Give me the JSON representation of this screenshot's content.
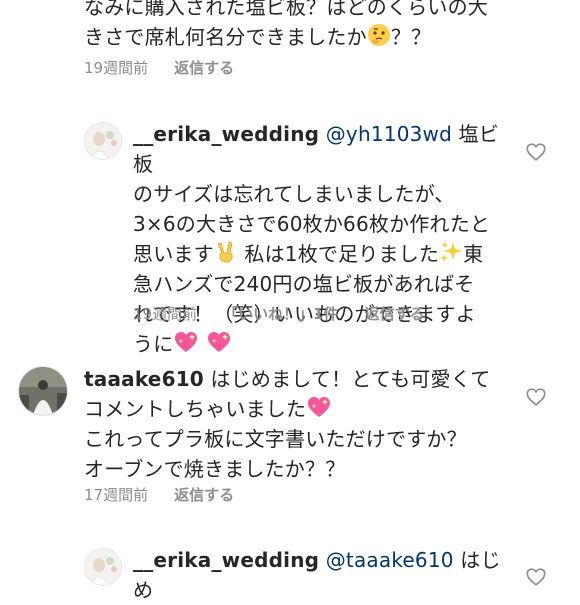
{
  "comments": [
    {
      "text": "なみに購入された塩ビ板？はどのくらいの大\nきさで席札何名分できましたか",
      "text_tail": "？？",
      "time": "19週間前",
      "reply": "返信する"
    },
    {
      "username": "__erika_wedding",
      "mention": "@yh1103wd",
      "line1": " 塩ビ板",
      "body1": "のサイズは忘れてしまいましたが、\n3×6の大きさで60枚か66枚か作れたと\n思います",
      "body2": " 私は1枚で足りました",
      "body3": "東\n急ハンズで240円の塩ビ板があればそ\nれです！（笑）いいものができますよ\nうに",
      "time": "19週間前",
      "likes": "「いいね！」1件",
      "reply": "返信する"
    },
    {
      "username": "taaake610",
      "body1": " はじめまして！とても可愛くて\nコメントしちゃいました",
      "body2": "\nこれってプラ板に文字書いただけですか？\nオーブンで焼きましたか？？",
      "time": "17週間前",
      "reply": "返信する"
    },
    {
      "username": "__erika_wedding",
      "mention": "@taaake610",
      "body1": " はじめ"
    }
  ],
  "icons": [
    "thinking-emoji",
    "victory-hand-emoji",
    "sparkles-emoji",
    "sparkling-heart-emoji",
    "heart-outline-icon"
  ],
  "colors": {
    "text": "#262626",
    "meta": "#8e8e8e",
    "mention": "#00376b"
  }
}
